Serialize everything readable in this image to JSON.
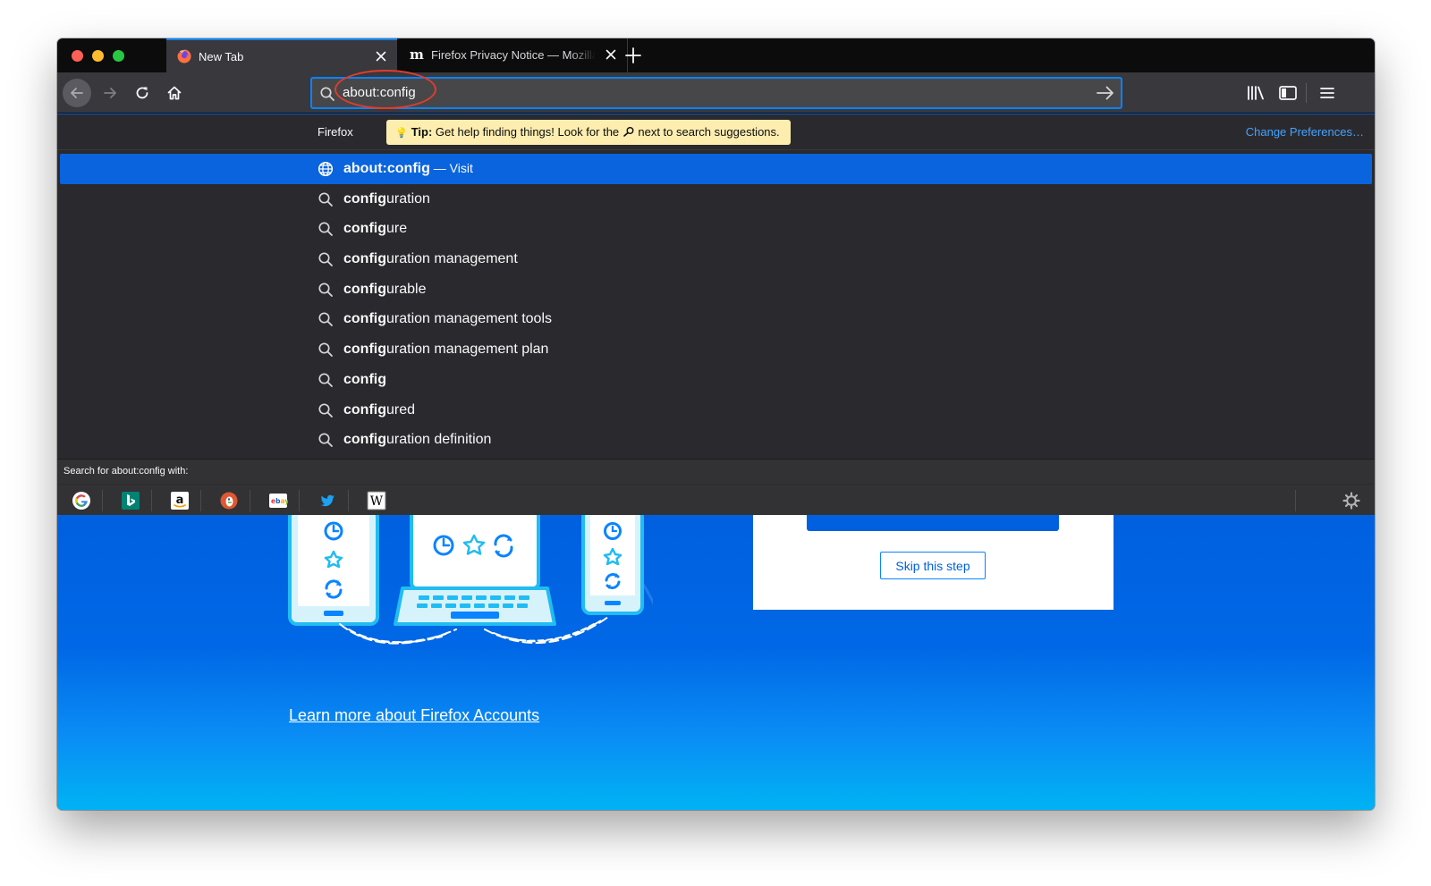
{
  "tabs": [
    {
      "title": "New Tab"
    },
    {
      "title": "Firefox Privacy Notice — Mozilla"
    }
  ],
  "urlbar": {
    "value": "about:config"
  },
  "dropdown": {
    "engine_label": "Firefox",
    "tip": {
      "strong": "Tip:",
      "text_before": " Get help finding things! Look for the ",
      "text_after": " next to search suggestions."
    },
    "change_preferences": "Change Preferences…",
    "results": [
      {
        "bold": "about:config",
        "rest": "",
        "action": " — Visit",
        "icon": "globe-icon"
      },
      {
        "bold": "config",
        "rest": "uration",
        "icon": "search-icon"
      },
      {
        "bold": "config",
        "rest": "ure",
        "icon": "search-icon"
      },
      {
        "bold": "config",
        "rest": "uration management",
        "icon": "search-icon"
      },
      {
        "bold": "config",
        "rest": "urable",
        "icon": "search-icon"
      },
      {
        "bold": "config",
        "rest": "uration management tools",
        "icon": "search-icon"
      },
      {
        "bold": "config",
        "rest": "uration management plan",
        "icon": "search-icon"
      },
      {
        "bold": "config",
        "rest": "",
        "icon": "search-icon"
      },
      {
        "bold": "config",
        "rest": "ured",
        "icon": "search-icon"
      },
      {
        "bold": "config",
        "rest": "uration definition",
        "icon": "search-icon"
      }
    ],
    "search_with_label": "Search for about:config with:",
    "engines": [
      "google-icon",
      "bing-icon",
      "amazon-icon",
      "duckduckgo-icon",
      "ebay-icon",
      "twitter-icon",
      "wikipedia-icon"
    ]
  },
  "page": {
    "skip_label": "Skip this step",
    "learn_more": "Learn more about Firefox Accounts"
  },
  "colors": {
    "accent": "#0a84ff",
    "selected_row": "#0a64dd",
    "page_bg": "#0060df",
    "annotation": "#e03c2d"
  }
}
